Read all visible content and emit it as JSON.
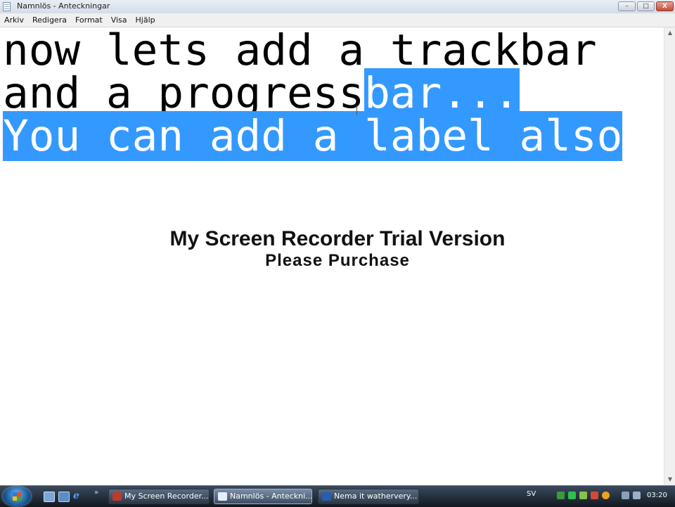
{
  "window": {
    "title": "Namnlös - Anteckningar",
    "buttons": {
      "minimize": "–",
      "maximize": "□",
      "close": "X"
    }
  },
  "menu": {
    "items": [
      "Arkiv",
      "Redigera",
      "Format",
      "Visa",
      "Hjälp"
    ]
  },
  "editor": {
    "line1": "now lets add a trackbar",
    "line2_plain": "and a progress",
    "line2_selected": "bar...",
    "line3_selected": "You can add a label also",
    "selection_color": "#3399ff"
  },
  "watermark": {
    "line1": "My Screen Recorder Trial Version",
    "line2": "Please Purchase"
  },
  "scrollbar": {
    "up": "▲",
    "down": "▼"
  },
  "taskbar": {
    "quicklaunch_more": "»",
    "tasks": [
      {
        "label": "My Screen Recorder...",
        "icon": "recorder-icon",
        "active": false
      },
      {
        "label": "Namnlös - Anteckni...",
        "icon": "notepad-icon",
        "active": true
      },
      {
        "label": "Nema it wathervery...",
        "icon": "word-icon",
        "active": false
      }
    ],
    "language": "SV",
    "clock": "03:20"
  }
}
